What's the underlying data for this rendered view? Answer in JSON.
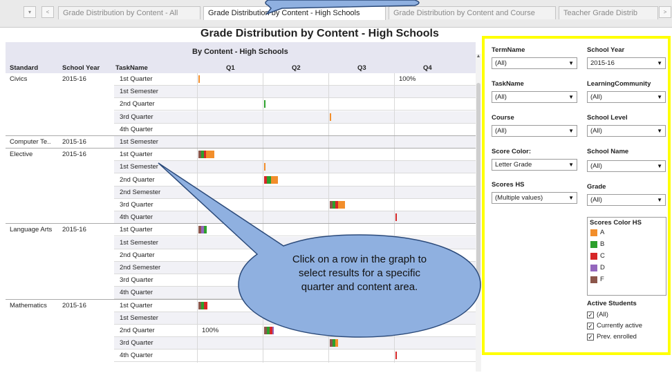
{
  "tabs": {
    "nav_down": "▾",
    "nav_prev": "<",
    "nav_next": ">",
    "items": [
      {
        "label": "Grade Distribution by Content - All"
      },
      {
        "label": "Grade Distribution by Content - High Schools"
      },
      {
        "label": "Grade Distribution by Content and Course"
      },
      {
        "label": "Teacher Grade Distrib"
      }
    ]
  },
  "dashboard": {
    "title": "Grade Distribution by Content - High Schools",
    "subtitle": "By Content - High Schools",
    "columns": {
      "standard": "Standard",
      "school_year": "School Year",
      "taskname": "TaskName",
      "q1": "Q1",
      "q2": "Q2",
      "q3": "Q3",
      "q4": "Q4"
    }
  },
  "groups": [
    {
      "standard": "Civics",
      "year": "2015-16",
      "rows": [
        {
          "task": "1st Quarter",
          "pct": "100%",
          "pct_col": 3
        },
        {
          "task": "1st Semester"
        },
        {
          "task": "2nd Quarter"
        },
        {
          "task": "3rd Quarter"
        },
        {
          "task": "4th Quarter"
        }
      ]
    },
    {
      "standard": "Computer Te..",
      "year": "2015-16",
      "rows": [
        {
          "task": "1st Semester"
        }
      ]
    },
    {
      "standard": "Elective",
      "year": "2015-16",
      "rows": [
        {
          "task": "1st Quarter"
        },
        {
          "task": "1st Semester"
        },
        {
          "task": "2nd Quarter"
        },
        {
          "task": "2nd Semester"
        },
        {
          "task": "3rd Quarter"
        },
        {
          "task": "4th Quarter"
        }
      ]
    },
    {
      "standard": "Language Arts",
      "year": "2015-16",
      "rows": [
        {
          "task": "1st Quarter"
        },
        {
          "task": "1st Semester"
        },
        {
          "task": "2nd Quarter"
        },
        {
          "task": "2nd Semester"
        },
        {
          "task": "3rd Quarter"
        },
        {
          "task": "4th Quarter"
        }
      ]
    },
    {
      "standard": "Mathematics",
      "year": "2015-16",
      "rows": [
        {
          "task": "1st Quarter"
        },
        {
          "task": "1st Semester"
        },
        {
          "task": "2nd Quarter",
          "pct": "100%",
          "pct_col": 0
        },
        {
          "task": "3rd Quarter"
        },
        {
          "task": "4th Quarter"
        }
      ]
    }
  ],
  "filters": {
    "term_name": {
      "label": "TermName",
      "value": "(All)"
    },
    "school_year": {
      "label": "School Year",
      "value": "2015-16"
    },
    "task_name": {
      "label": "TaskName",
      "value": "(All)"
    },
    "learning_community": {
      "label": "LearningCommunity",
      "value": "(All)"
    },
    "course": {
      "label": "Course",
      "value": "(All)"
    },
    "school_level": {
      "label": "School Level",
      "value": "(All)"
    },
    "score_color": {
      "label": "Score Color:",
      "value": "Letter Grade"
    },
    "school_name": {
      "label": "School Name",
      "value": "(All)"
    },
    "scores_hs": {
      "label": "Scores HS",
      "value": "(Multiple values)"
    },
    "grade": {
      "label": "Grade",
      "value": "(All)"
    }
  },
  "legend": {
    "title": "Scores Color HS",
    "items": [
      {
        "label": "A",
        "color": "#f28e2b"
      },
      {
        "label": "B",
        "color": "#2ca02c"
      },
      {
        "label": "C",
        "color": "#d62728"
      },
      {
        "label": "D",
        "color": "#9467bd"
      },
      {
        "label": "F",
        "color": "#8c564b"
      }
    ]
  },
  "active_students": {
    "title": "Active Students",
    "items": [
      {
        "label": "(All)",
        "checked": "✓"
      },
      {
        "label": "Currently active",
        "checked": "✓"
      },
      {
        "label": "Prev. enrolled",
        "checked": "✓"
      }
    ]
  },
  "callout": {
    "text": "Click on a row in the graph to select results for a specific quarter and content area.",
    "fill_color": "#8fb0e0",
    "highlight_color": "#ffff00"
  }
}
